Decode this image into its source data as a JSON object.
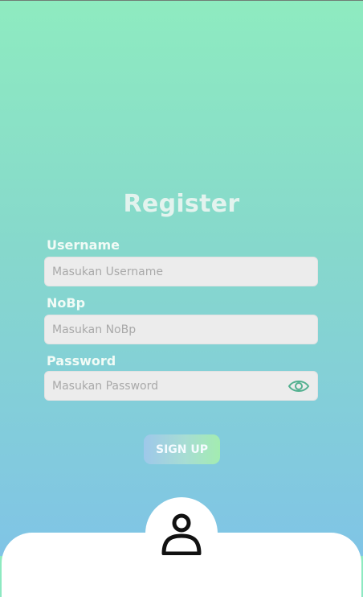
{
  "page": {
    "title": "Register"
  },
  "form": {
    "username": {
      "label": "Username",
      "placeholder": "Masukan Username"
    },
    "nobp": {
      "label": "NoBp",
      "placeholder": "Masukan NoBp"
    },
    "password": {
      "label": "Password",
      "placeholder": "Masukan Password",
      "toggle_icon": "eye-icon"
    },
    "submit_label": "SIGN UP"
  },
  "avatar": {
    "icon": "user-icon"
  },
  "colors": {
    "gradient_top": "#8eebc0",
    "gradient_bottom": "#80c4e6",
    "eye_icon": "#52b08f",
    "input_bg": "#ececec"
  }
}
